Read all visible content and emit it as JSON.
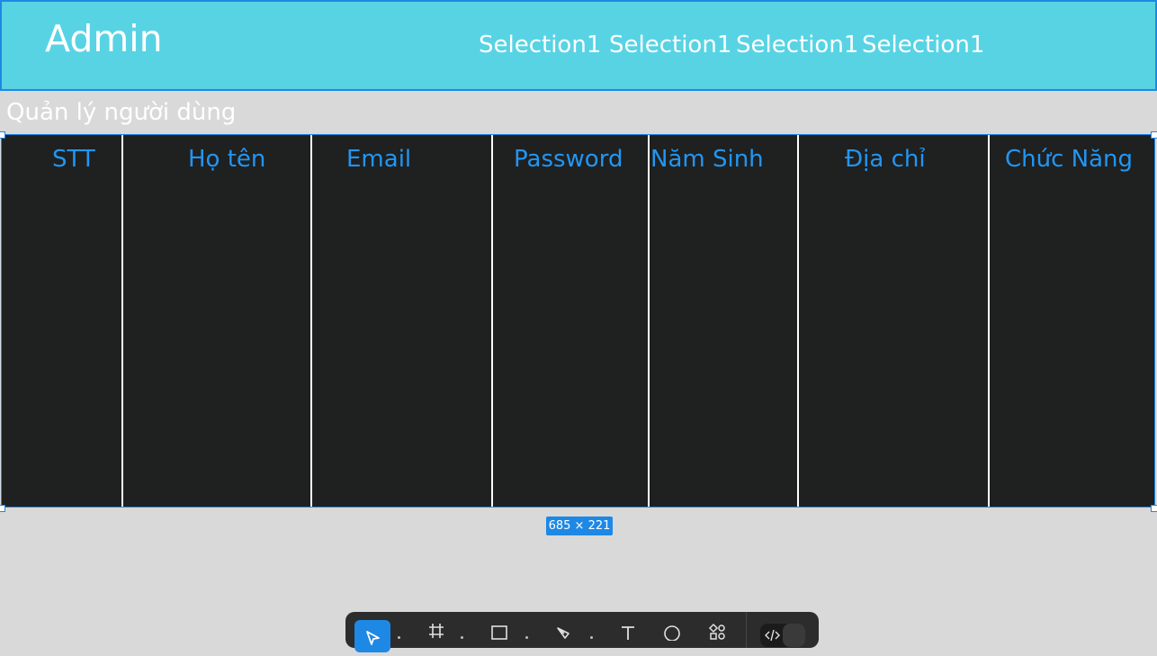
{
  "header": {
    "app_title": "Admin",
    "nav_items": [
      "Selection1",
      "Selection1",
      "Selection1",
      "Selection1"
    ]
  },
  "section_title": "Quản lý người dùng",
  "table": {
    "columns": [
      "STT",
      "Họ tên",
      "Email",
      "Password",
      "Năm Sinh",
      "Địa chỉ",
      "Chức Năng"
    ]
  },
  "selection_badge": "685 × 221",
  "colors": {
    "header_bg": "#58d3e4",
    "accent": "#1e88e5",
    "table_bg": "#1f2020",
    "column_text": "#2196f3",
    "canvas_bg": "#d9d9d9"
  },
  "toolbar": {
    "tools": [
      "move-icon",
      "frame-icon",
      "rectangle-icon",
      "pen-icon",
      "text-icon",
      "comment-icon",
      "actions-icon"
    ],
    "dev_mode_icon": "code-icon"
  }
}
